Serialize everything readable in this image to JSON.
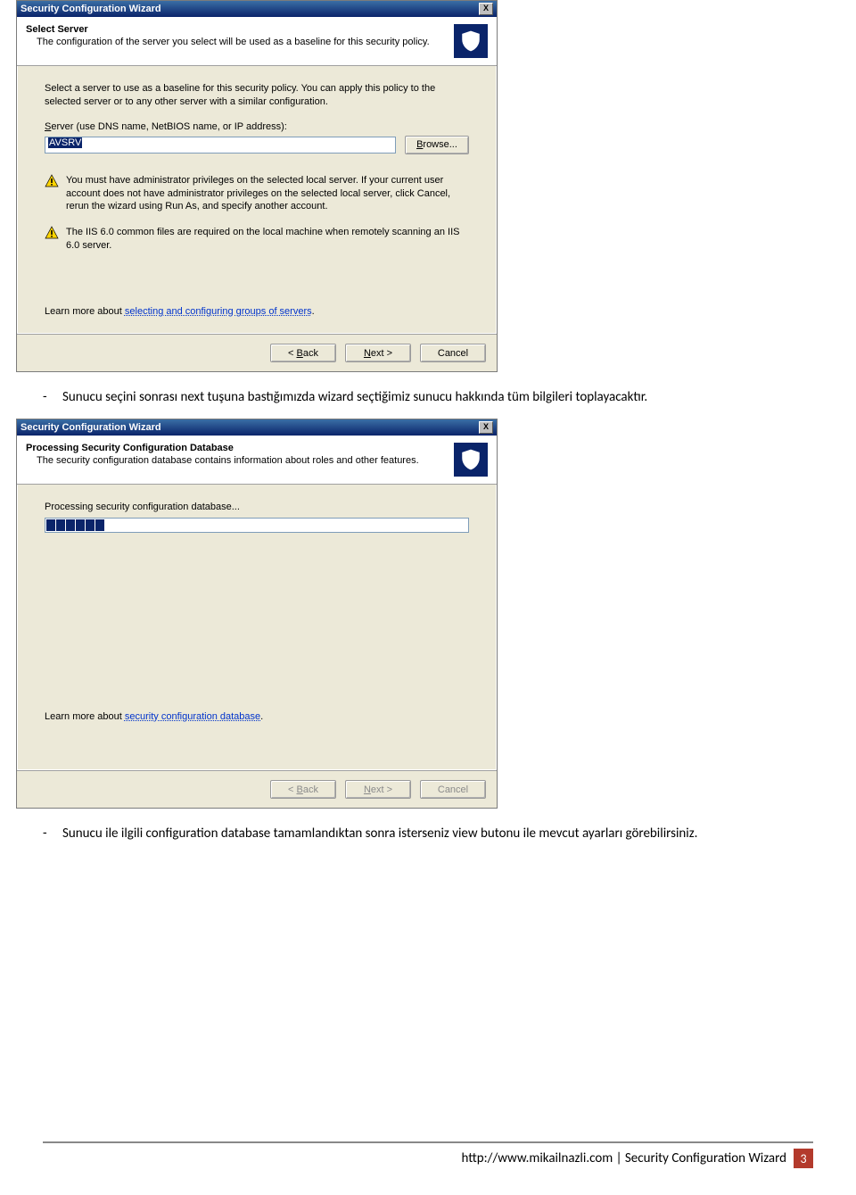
{
  "wizard1": {
    "title": "Security Configuration Wizard",
    "close": "X",
    "header_title": "Select Server",
    "header_subtitle": "The configuration of the server you select will be used as a baseline for this security policy.",
    "instruction": "Select a server to use as a baseline for this security policy. You can apply this policy to the selected server or to any other server with a similar configuration.",
    "field_label_pre": "S",
    "field_label_rest": "erver (use DNS name, NetBIOS name, or IP address):",
    "server_value": "AVSRV",
    "browse_pre": "B",
    "browse_rest": "rowse...",
    "warn1": "You must have administrator privileges on the selected local server. If your current user account does not have administrator privileges on the selected local server, click Cancel, rerun the wizard using Run As, and specify another account.",
    "warn2": "The IIS 6.0 common files are required on the local machine when remotely scanning an IIS 6.0 server.",
    "learn_pre": "Learn more about ",
    "learn_link": "selecting and configuring groups of servers",
    "learn_post": ".",
    "back_pre": "< ",
    "back_u": "B",
    "back_rest": "ack",
    "next_u": "N",
    "next_rest": "ext >",
    "cancel": "Cancel"
  },
  "doc_para1": "Sunucu seçini sonrası next tuşuna bastığımızda wizard seçtiğimiz sunucu hakkında tüm bilgileri toplayacaktır.",
  "wizard2": {
    "title": "Security Configuration Wizard",
    "close": "X",
    "header_title": "Processing Security Configuration Database",
    "header_subtitle": "The security configuration database contains information about roles and other features.",
    "progress_label": "Processing security configuration database...",
    "learn_pre": "Learn more about ",
    "learn_link": "security configuration database",
    "learn_post": ".",
    "back_pre": "< ",
    "back_u": "B",
    "back_rest": "ack",
    "next_u": "N",
    "next_rest": "ext >",
    "cancel": "Cancel"
  },
  "doc_para2": "Sunucu ile ilgili configuration database tamamlandıktan sonra isterseniz view butonu ile mevcut ayarları görebilirsiniz.",
  "footer": {
    "text": "http://www.mikailnazli.com | Security Configuration Wizard",
    "page": "3"
  }
}
